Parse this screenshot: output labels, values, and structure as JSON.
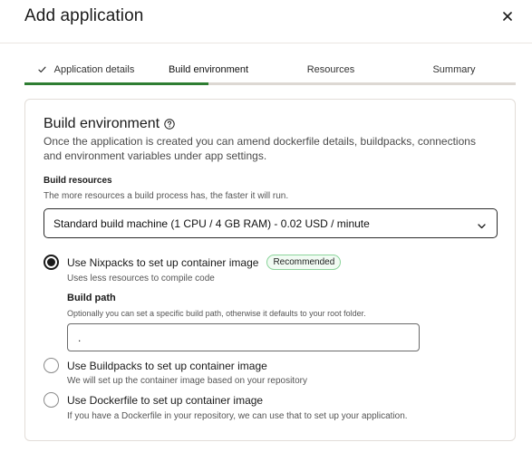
{
  "dialog": {
    "title": "Add application",
    "close_icon": "close-icon"
  },
  "steps": [
    {
      "label": "Application details",
      "completed": true,
      "icon": "check-icon"
    },
    {
      "label": "Build environment",
      "active": true
    },
    {
      "label": "Resources"
    },
    {
      "label": "Summary"
    }
  ],
  "progress_fraction": 0.375,
  "section": {
    "title": "Build environment",
    "help_icon": "help-circle-icon",
    "description": "Once the application is created you can amend dockerfile details, buildpacks, connections and environment variables under app settings."
  },
  "build_resources": {
    "label": "Build resources",
    "description": "The more resources a build process has, the faster it will run.",
    "selected": "Standard build machine (1 CPU / 4 GB RAM) - 0.02 USD / minute",
    "dropdown_icon": "chevron-down-icon"
  },
  "options": [
    {
      "label": "Use Nixpacks to set up container image",
      "badge": "Recommended",
      "description": "Uses less resources to compile code",
      "checked": true
    },
    {
      "label": "Use Buildpacks to set up container image",
      "description": "We will set up the container image based on your repository",
      "checked": false
    },
    {
      "label": "Use Dockerfile to set up container image",
      "description": "If you have a Dockerfile in your repository, we can use that to set up your application.",
      "checked": false
    }
  ],
  "build_path": {
    "label": "Build path",
    "description": "Optionally you can set a specific build path, otherwise it defaults to your root folder.",
    "value": "."
  },
  "colors": {
    "progress": "#2e7d32",
    "badge_border": "#8bd49b"
  }
}
